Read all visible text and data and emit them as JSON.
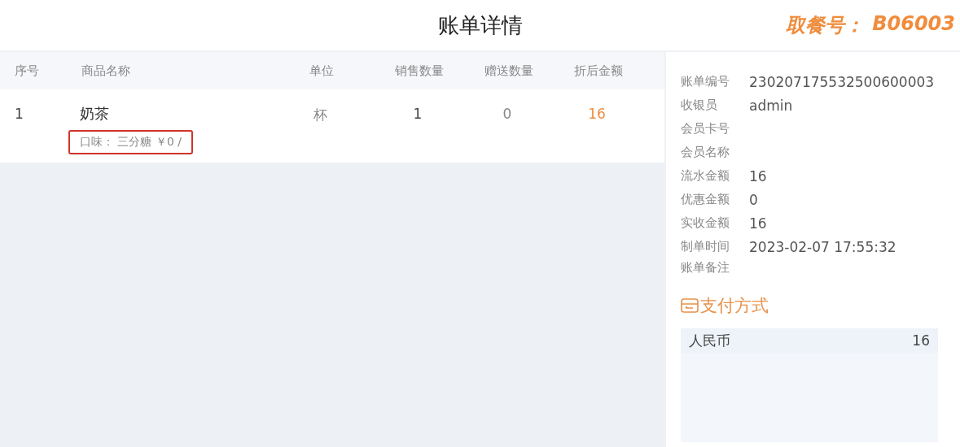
{
  "header": {
    "title": "账单详情",
    "pickup_label": "取餐号：",
    "pickup_number": "B06003"
  },
  "table": {
    "columns": [
      "序号",
      "商品名称",
      "单位",
      "销售数量",
      "赠送数量",
      "折后金额"
    ],
    "rows": [
      {
        "index": "1",
        "name": "奶茶",
        "spec": "口味： 三分糖 ￥0 /",
        "spec_highlighted": true,
        "unit": "杯",
        "sold": "1",
        "gift": "0",
        "amount": "16"
      }
    ]
  },
  "details": [
    {
      "label": "账单编号",
      "value": "230207175532500600003"
    },
    {
      "label": "收银员",
      "value": "admin"
    },
    {
      "label": "会员卡号"
    },
    {
      "label": "会员名称"
    },
    {
      "label": "流水金额",
      "value": "16"
    },
    {
      "label": "优惠金额",
      "value": "0"
    },
    {
      "label": "实收金额",
      "value": "16"
    },
    {
      "label": "制单时间",
      "value": "2023-02-07 17:55:32"
    },
    {
      "label": "账单备注"
    }
  ],
  "payment": {
    "title": "支付方式",
    "methods": [
      {
        "name": "人民币",
        "amount": "16"
      }
    ]
  }
}
